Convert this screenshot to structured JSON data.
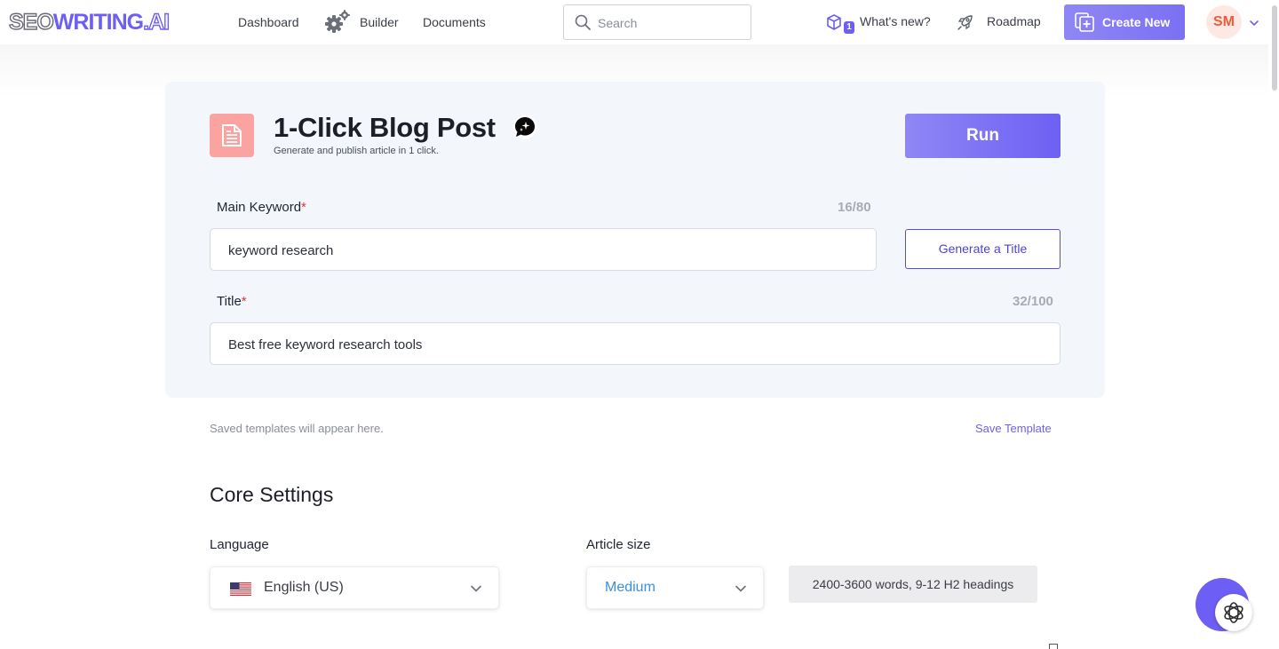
{
  "brand": {
    "seo": "SEO",
    "writing": "WRITING",
    "ai": ".AI"
  },
  "nav": {
    "dashboard": "Dashboard",
    "builder": "Builder",
    "documents": "Documents"
  },
  "search": {
    "placeholder": "Search"
  },
  "header": {
    "whats_new": "What's new?",
    "whats_new_badge": "1",
    "roadmap": "Roadmap",
    "create_new": "Create New",
    "avatar_initials": "SM"
  },
  "tool": {
    "title": "1-Click Blog Post",
    "subtitle": "Generate and publish article in 1 click.",
    "run_label": "Run"
  },
  "form": {
    "main_keyword": {
      "label": "Main Keyword",
      "required_mark": "*",
      "counter": "16/80",
      "value": "keyword research"
    },
    "generate_title_label": "Generate a Title",
    "title": {
      "label": "Title",
      "required_mark": "*",
      "counter": "32/100",
      "value": "Best free keyword research tools"
    }
  },
  "templates": {
    "empty_text": "Saved templates will appear here.",
    "save_label": "Save Template"
  },
  "core_settings": {
    "heading": "Core Settings",
    "language_label": "Language",
    "language_value": "English (US)",
    "article_size_label": "Article size",
    "article_size_value": "Medium",
    "article_size_info": "2400-3600 words, 9-12 H2 headings"
  },
  "colors": {
    "accent": "#6d5ff5",
    "doc_icon_bg": "#fba3a0",
    "card_bg": "#f3f7fc"
  },
  "icons": [
    "gear-icon",
    "search-icon",
    "cube-icon",
    "rocket-icon",
    "add-document-icon",
    "chevron-down-icon",
    "document-icon",
    "chat-sparkle-icon",
    "us-flag-icon",
    "openai-icon"
  ]
}
